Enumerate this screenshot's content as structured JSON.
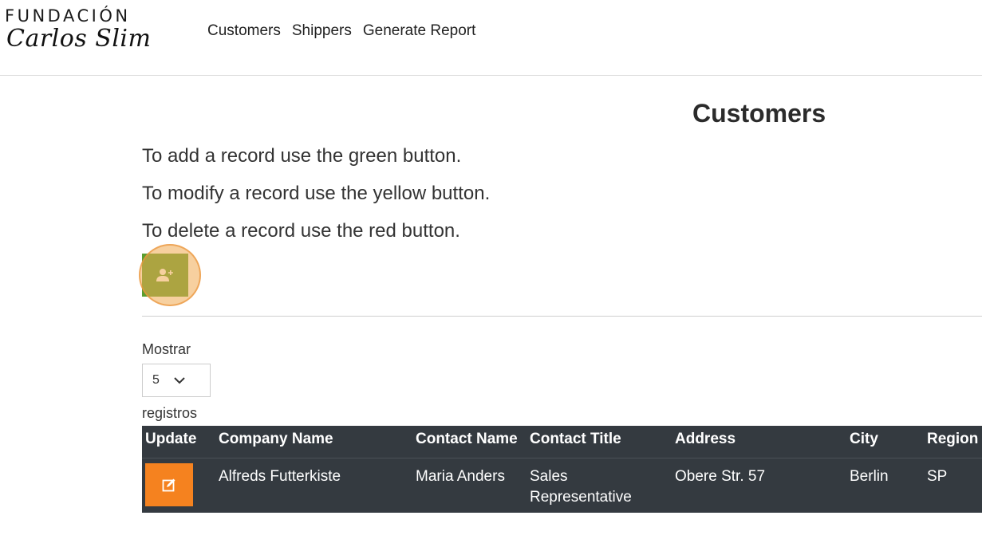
{
  "header": {
    "logo_top": "FUNDACIÓN",
    "logo_bottom": "Carlos Slim",
    "nav": [
      "Customers",
      "Shippers",
      "Generate Report"
    ]
  },
  "page": {
    "title": "Customers",
    "instructions": [
      "To add a record use the green button.",
      "To modify a record use the yellow button.",
      "To delete a record use the red button."
    ],
    "add_icon": "add-user-icon"
  },
  "length_menu": {
    "label_before": "Mostrar",
    "selected": "5",
    "label_after": "registros"
  },
  "table": {
    "columns": [
      "Update",
      "Company Name",
      "Contact Name",
      "Contact Title",
      "Address",
      "City",
      "Region"
    ],
    "rows": [
      {
        "company": "Alfreds Futterkiste",
        "contact_name": "Maria Anders",
        "contact_title": "Sales Representative",
        "address": "Obere Str. 57",
        "city": "Berlin",
        "region": "SP"
      }
    ]
  },
  "colors": {
    "add_button": "#5a9e2f",
    "edit_button": "#f5821f",
    "table_header": "#343a40"
  }
}
